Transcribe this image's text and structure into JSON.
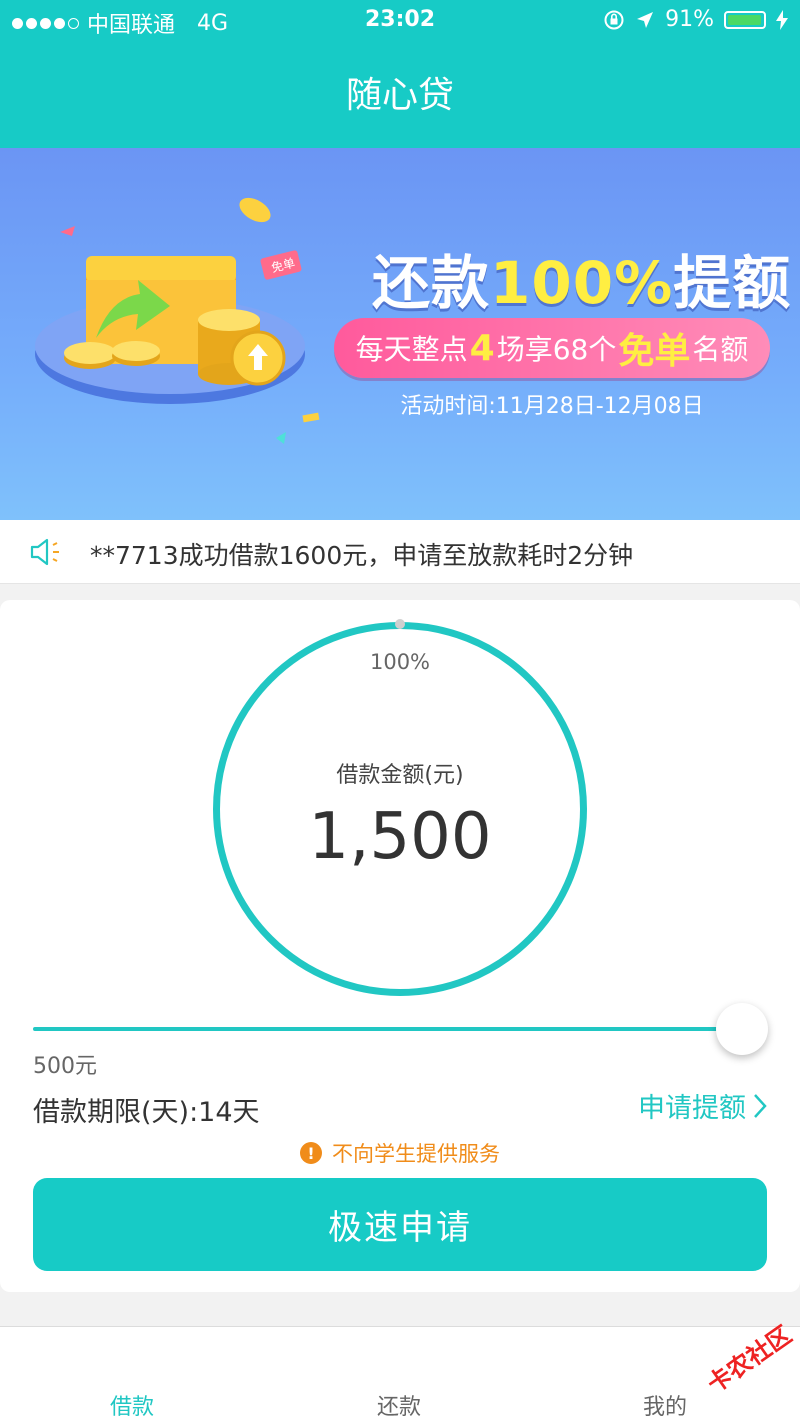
{
  "status_bar": {
    "carrier": "中国联通",
    "network": "4G",
    "time": "23:02",
    "battery": "91%"
  },
  "nav": {
    "title": "随心贷"
  },
  "banner": {
    "title_part1": "还款",
    "title_pct": "100%",
    "title_part2": "提额",
    "pill_part1": "每天整点",
    "pill_num": "4",
    "pill_part2": "场享68个",
    "pill_free": "免单",
    "pill_part3": "名额",
    "period": "活动时间:11月28日-12月08日",
    "tag": "免单"
  },
  "notice": {
    "text": "**7713成功借款1600元，申请至放款耗时2分钟"
  },
  "loan": {
    "ring_percent": "100%",
    "amount_label": "借款金额(元)",
    "amount": "1,500",
    "slider_fraction": 1.0,
    "min_amount": "500元",
    "term": "借款期限(天):14天",
    "raise_limit": "申请提额",
    "warning": "不向学生提供服务",
    "apply_button": "极速申请"
  },
  "tabs": [
    {
      "label": "借款",
      "active": true
    },
    {
      "label": "还款",
      "active": false
    },
    {
      "label": "我的",
      "active": false
    }
  ],
  "watermark": "卡农社区",
  "colors": {
    "accent": "#17cbc6",
    "warning": "#f08c1a",
    "pill": "#ff5a9c",
    "highlight": "#ffee42"
  }
}
